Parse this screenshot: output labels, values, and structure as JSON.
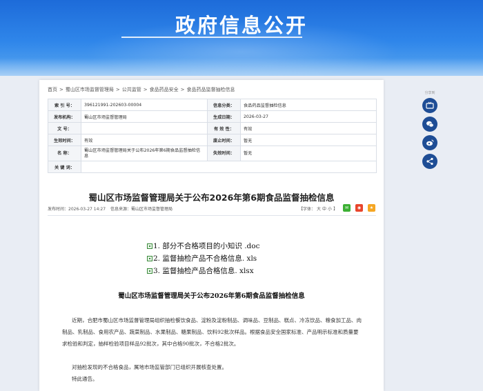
{
  "banner": {
    "title": "政府信息公开"
  },
  "breadcrumb": [
    "首页",
    ">",
    "蜀山区市场监督管理局",
    ">",
    "公共监管",
    ">",
    "食品药品安全",
    ">",
    "食品药品监督抽检信息"
  ],
  "meta": {
    "index_label": "索 引 号：",
    "index_value": "396121991-202603-00004",
    "category_label": "信息分类：",
    "category_value": "食品药品监督抽检信息",
    "publisher_label": "发布机构：",
    "publisher_value": "蜀山区市场监督管理局",
    "created_label": "生成日期：",
    "created_value": "2026-03-27",
    "docno_label": "文 号：",
    "docno_value": "",
    "validity_label": "有 效 性：",
    "validity_value": "有效",
    "effective_label": "生效时间：",
    "effective_value": "有效",
    "repeal_label": "废止时间：",
    "repeal_value": "暂无",
    "name_label": "名 称：",
    "name_value": "蜀山区市场监督管理局关于公布2026年第6期食品监督抽检信息",
    "expire_label": "失效时间：",
    "expire_value": "暂无",
    "keywords_label": "关 键 词：",
    "keywords_value": ""
  },
  "article": {
    "title": "蜀山区市场监督管理局关于公布2026年第6期食品监督抽检信息",
    "publish_time": "发布时间：2026-03-27 14:27",
    "source": "信息来源：蜀山区市场监督管理局",
    "font_label": "【字体：",
    "font_large": "大",
    "font_medium": "中",
    "font_small": "小",
    "font_close": "】",
    "attachments": [
      "1. 部分不合格项目的小知识 .doc",
      "2. 监督抽检产品不合格信息. xls",
      "3. 监督抽检产品合格信息. xlsx"
    ],
    "content_title": "蜀山区市场监督管理局关于公布2026年第6期食品监督抽检信息",
    "paragraphs": [
      "近期，合肥市蜀山区市场监督管理局组织抽检餐饮食品、淀粉及淀粉制品、调味品、豆制品、糕点、冷冻饮品、粮食加工品、肉制品、乳制品、食用农产品、蔬菜制品、水果制品、糖果制品、饮料92批次样品。根据食品安全国家标准、产品明示标准和质量要求检验和判定，抽样检验项目样品92批次，其中合格90批次，不合格2批次。",
      "对抽检发现的不合格食品，属地市场监管部门已组织开展核查处置。",
      "特此通告。"
    ]
  },
  "share": {
    "label": "分享到"
  },
  "colors": {
    "banner": "#2f86ea",
    "share_icon": "#1e4d95",
    "wechat": "#3cb034",
    "weibo": "#e8452c",
    "qzone": "#f5a623"
  }
}
